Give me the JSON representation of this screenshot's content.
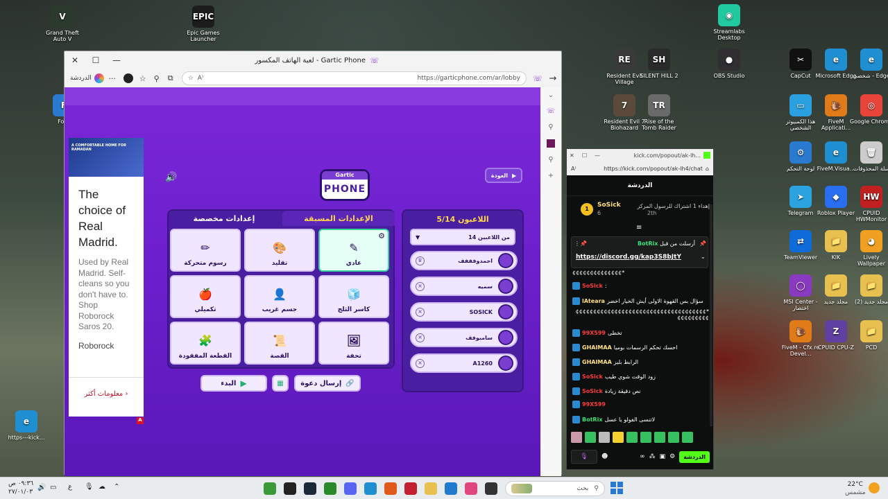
{
  "desktop": {
    "icons": [
      {
        "label": "Grand Theft Auto V",
        "glyph": "V",
        "color": "#2c3a2e"
      },
      {
        "label": "Epic Games Launcher",
        "glyph": "EPIC",
        "color": "#1c1c1c"
      },
      {
        "label": "Streamlabs Desktop",
        "glyph": "◉",
        "color": "#20c9a0"
      },
      {
        "label": "Resident Evil Village",
        "glyph": "RE",
        "color": "#3a3a3a"
      },
      {
        "label": "SILENT HILL 2",
        "glyph": "SH",
        "color": "#2a2a2a"
      },
      {
        "label": "OBS Studio",
        "glyph": "●",
        "color": "#302e31"
      },
      {
        "label": "CapCut",
        "glyph": "✂",
        "color": "#111"
      },
      {
        "label": "Microsoft Edge",
        "glyph": "e",
        "color": "#1f8fd1"
      },
      {
        "label": "شخصي - Edge",
        "glyph": "e",
        "color": "#1f8fd1"
      },
      {
        "label": "Resident Evil 7 Biohazard",
        "glyph": "7",
        "color": "#5b4a3a"
      },
      {
        "label": "Rise of the Tomb Raider",
        "glyph": "TR",
        "color": "#6a6a6a"
      },
      {
        "label": "هذا الكمبيوتر الشخصي",
        "glyph": "▭",
        "color": "#2aa0e0"
      },
      {
        "label": "FiveM Applicati...",
        "glyph": "🐌",
        "color": "#e07b1a"
      },
      {
        "label": "Google Chrome",
        "glyph": "◎",
        "color": "#e8443a"
      },
      {
        "label": "لوحة التحكم",
        "glyph": "⚙",
        "color": "#2a7ad0"
      },
      {
        "label": "FiveM.Visua...",
        "glyph": "e",
        "color": "#1f8fd1"
      },
      {
        "label": "سلة المحذوفات",
        "glyph": "🗑",
        "color": "#ccc"
      },
      {
        "label": "Telegram",
        "glyph": "➤",
        "color": "#2aa3e0"
      },
      {
        "label": "Roblox Player",
        "glyph": "◆",
        "color": "#2a6ef0"
      },
      {
        "label": "CPUID HWMonitor",
        "glyph": "HW",
        "color": "#c02020"
      },
      {
        "label": "TeamViewer",
        "glyph": "⇄",
        "color": "#0e6bd8"
      },
      {
        "label": "KIK",
        "glyph": "📁",
        "color": "#e8c050"
      },
      {
        "label": "Lively Wallpaper",
        "glyph": "◕",
        "color": "#f0a020"
      },
      {
        "label": "MSI Center - اختصار",
        "glyph": "◯",
        "color": "#8a3ac0"
      },
      {
        "label": "مجلد جديد",
        "glyph": "📁",
        "color": "#e8c050"
      },
      {
        "label": "مجلد جديد (2)",
        "glyph": "📁",
        "color": "#e8c050"
      },
      {
        "label": "FiveM - Cfx.re Devel...",
        "glyph": "🐌",
        "color": "#e07b1a"
      },
      {
        "label": "CPUID CPU-Z",
        "glyph": "Z",
        "color": "#6040a0"
      },
      {
        "label": "PCD",
        "glyph": "📁",
        "color": "#e8c050"
      },
      {
        "label": "Forti",
        "glyph": "F",
        "color": "#2a7ad0"
      },
      {
        "label": "https---kick...",
        "glyph": "e",
        "color": "#1f8fd1"
      }
    ]
  },
  "browser": {
    "title": "لعبة الهاتف المكسور - Gartic Phone",
    "chat_label": "الدردشة",
    "url": "https://garticphone.com/ar/lobby"
  },
  "ad": {
    "banner_text": "A COMFORTABLE HOME FOR RAMADAN",
    "headline": "The choice of Real Madrid.",
    "body": "Used by Real Madrid. Self-cleans so you don't have to. Shop Roborock Saros 20.",
    "brand": "Roborock",
    "cta": "معلومات أكثر"
  },
  "game": {
    "logo_top": "Gartic",
    "logo_bottom": "PHONE",
    "back_button": "العودة",
    "players_title": "اللاعبون 5/14",
    "max_players": "14 من اللاعبين",
    "players": [
      "احمدوفففف",
      "سميه",
      "SOSICK",
      "سامبوفف",
      "A1260"
    ],
    "tabs": {
      "preset": "الإعدادات المسبقة",
      "custom": "إعدادات مخصصة"
    },
    "modes": [
      {
        "label": "عادي",
        "icon": "✎",
        "selected": true
      },
      {
        "label": "تقليد",
        "icon": "🎨",
        "selected": false
      },
      {
        "label": "رسوم متحركة",
        "icon": "✏",
        "selected": false
      },
      {
        "label": "كاسر الثلج",
        "icon": "🧊",
        "selected": false
      },
      {
        "label": "جسم غريب",
        "icon": "👤",
        "selected": false
      },
      {
        "label": "تكميلي",
        "icon": "🍎",
        "selected": false
      },
      {
        "label": "تحفة",
        "icon": "🖼",
        "selected": false
      },
      {
        "label": "القصة",
        "icon": "📜",
        "selected": false
      },
      {
        "label": "القطعة المفقودة",
        "icon": "🧩",
        "selected": false
      }
    ],
    "start_button": "البدء",
    "invite_button": "إرسال دعوة"
  },
  "kick": {
    "url_short": "kick.com/popout/ak-lh...",
    "url": "https://kick.com/popout/ak-lh4/chat",
    "chat_header": "الدردشة",
    "gift_user": "SoSick",
    "gift_count": "6",
    "gift_text": "إهداء 1 اشتراك للرسول المركز",
    "gift_time": "2th",
    "pinned_by": "أرسلت من قبل",
    "pinned_user": "BotRix",
    "pinned_link": "https://discord.gg/kap3S8bJtY",
    "messages": [
      {
        "user": "",
        "text": "*¢¢¢¢¢¢¢¢¢¢¢¢¢¢",
        "color": "#fff"
      },
      {
        "user": "SoSick",
        "text": ":",
        "color": "#ff3b3b"
      },
      {
        "user": "lAteara",
        "text": "سؤال بس القهوة الاولى أيش الخيار اخضر",
        "color": "#ffe07a"
      },
      {
        "user": "",
        "text": "*¢¢¢¢¢¢¢¢¢¢¢¢¢¢¢¢¢¢¢¢¢¢¢¢¢¢¢¢¢¢¢¢¢¢¢¢¢¢¢¢¢¢¢¢¢¢",
        "color": "#fff"
      },
      {
        "user": "99X599",
        "text": "تخطى",
        "color": "#ff3b3b"
      },
      {
        "user": "GHAIMAA",
        "text": "احسك تحكم الرسمات بوميا",
        "color": "#ffe07a"
      },
      {
        "user": "GHAIMAA",
        "text": "الرابط بليز",
        "color": "#ffe07a"
      },
      {
        "user": "SoSick",
        "text": "زود الوقت شوي طيب",
        "color": "#ff3b3b"
      },
      {
        "user": "SoSick",
        "text": "نص دقيقة زيادة",
        "color": "#ff3b3b"
      },
      {
        "user": "99X599",
        "text": "",
        "color": "#ff3b3b"
      },
      {
        "user": "BotRix",
        "text": "لاتنسى الفولو يا عسل",
        "color": "#36e07a"
      }
    ],
    "send_label": "الدردشة"
  },
  "taskbar": {
    "search": "بحث",
    "temp": "22°C",
    "weather": "مشمس",
    "time": "٠٩:٣٦ ص",
    "date": "٢٧/٠١/٠٣",
    "lang": "ع"
  }
}
